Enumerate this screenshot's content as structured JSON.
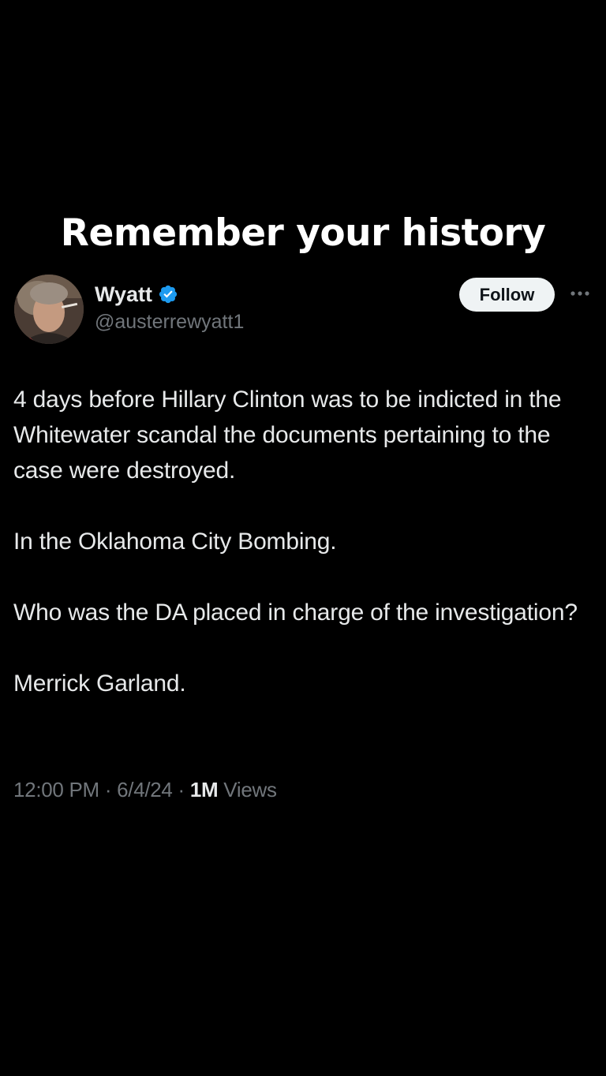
{
  "caption": "Remember your history",
  "colors": {
    "background": "#000000",
    "primary_text": "#e7e9ea",
    "secondary_text": "#71767b",
    "verified_blue": "#1d9bf0",
    "follow_button_bg": "#eff3f4"
  },
  "tweet": {
    "author": {
      "display_name": "Wyatt",
      "handle": "@austerrewyatt1",
      "verified": true,
      "avatar_icon": "profile-photo"
    },
    "follow_label": "Follow",
    "more_icon": "more-horizontal-icon",
    "paragraphs": [
      "4 days before Hillary Clinton was to be indicted in the Whitewater scandal the documents pertaining to the case were destroyed.",
      "In the Oklahoma City Bombing.",
      "Who was the DA placed in charge of the investigation?",
      "Merrick Garland."
    ],
    "meta": {
      "time": "12:00 PM",
      "separator": " · ",
      "date": "6/4/24",
      "views_count": "1M",
      "views_label": " Views"
    }
  }
}
